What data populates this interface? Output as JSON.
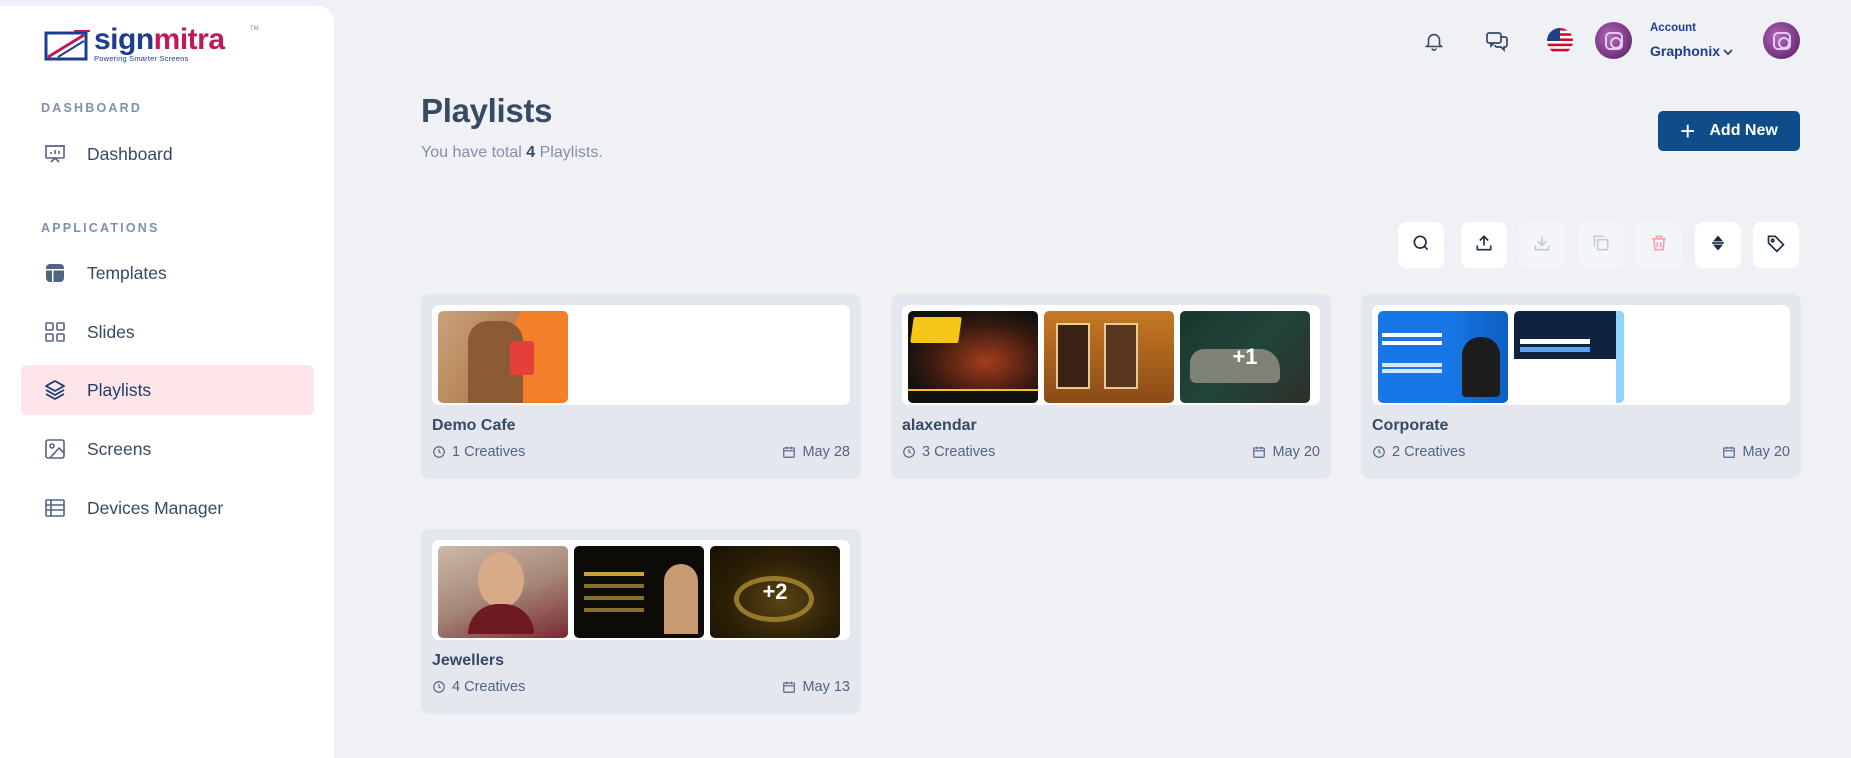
{
  "brand": {
    "name_part1": "sign",
    "name_part2": "mitra",
    "tagline": "Powering Smarter Screens",
    "tm": "TM"
  },
  "sidebar": {
    "sections": [
      {
        "heading": "DASHBOARD"
      },
      {
        "heading": "APPLICATIONS"
      }
    ],
    "items": [
      {
        "label": "Dashboard",
        "icon": "presentation-chart-icon"
      },
      {
        "label": "Templates",
        "icon": "template-layout-icon"
      },
      {
        "label": "Slides",
        "icon": "grid-apps-icon"
      },
      {
        "label": "Playlists",
        "icon": "layers-icon",
        "active": true
      },
      {
        "label": "Screens",
        "icon": "image-icon"
      },
      {
        "label": "Devices Manager",
        "icon": "table-list-icon"
      }
    ]
  },
  "header": {
    "account_label": "Account",
    "account_name": "Graphonix"
  },
  "page": {
    "title": "Playlists",
    "subtitle_prefix": "You have total ",
    "subtitle_count": "4",
    "subtitle_suffix": " Playlists.",
    "add_button": "Add New"
  },
  "playlists": [
    {
      "name": "Demo Cafe",
      "creatives": "1 Creatives",
      "date": "May 28"
    },
    {
      "name": "alaxendar",
      "creatives": "3 Creatives",
      "date": "May 20",
      "more": "+1"
    },
    {
      "name": "Corporate",
      "creatives": "2 Creatives",
      "date": "May 20"
    },
    {
      "name": "Jewellers",
      "creatives": "4 Creatives",
      "date": "May 13",
      "more": "+2"
    }
  ],
  "colors": {
    "primary": "#0e4c8a",
    "active_bg": "#fde5ea",
    "delete_disabled": "#f4a0ad"
  }
}
